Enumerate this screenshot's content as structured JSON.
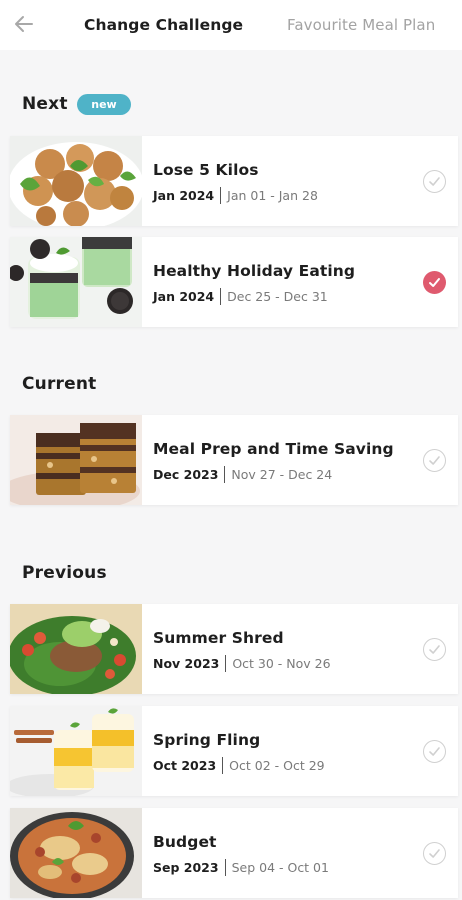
{
  "header": {
    "active_tab": "Change Challenge",
    "inactive_tab": "Favourite Meal Plan"
  },
  "sections": {
    "next": {
      "title": "Next",
      "badge": "new"
    },
    "current": {
      "title": "Current"
    },
    "previous": {
      "title": "Previous"
    }
  },
  "challenges": [
    {
      "title": "Lose 5 Kilos",
      "month": "Jan 2024",
      "range": "Jan 01 - Jan 28",
      "selected": false
    },
    {
      "title": "Healthy Holiday Eating",
      "month": "Jan 2024",
      "range": "Dec 25 - Dec 31",
      "selected": true
    },
    {
      "title": "Meal Prep and Time Saving",
      "month": "Dec 2023",
      "range": "Nov 27 - Dec 24",
      "selected": false
    },
    {
      "title": "Summer Shred",
      "month": "Nov 2023",
      "range": "Oct 30 - Nov 26",
      "selected": false
    },
    {
      "title": "Spring Fling",
      "month": "Oct 2023",
      "range": "Oct 02 - Oct 29",
      "selected": false
    },
    {
      "title": "Budget",
      "month": "Sep 2023",
      "range": "Sep 04 - Oct 01",
      "selected": false
    }
  ],
  "colors": {
    "accent_selected": "#df5a6e",
    "badge": "#4fb3c8"
  },
  "icons": {
    "back": "arrow-left-icon",
    "check": "checkmark-icon"
  }
}
